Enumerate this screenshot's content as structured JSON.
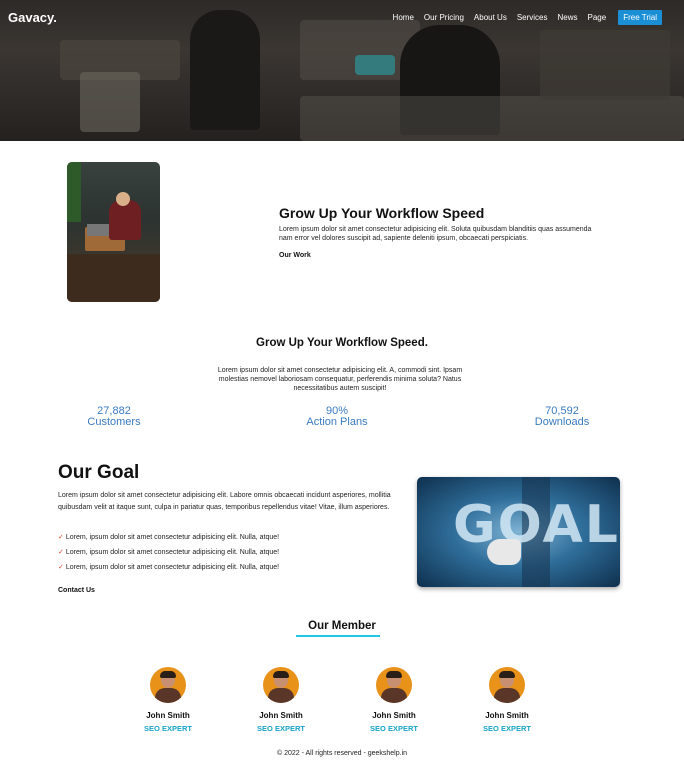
{
  "brand": {
    "logo": "Gavacy."
  },
  "nav": {
    "items": [
      "Home",
      "Our Pricing",
      "About Us",
      "Services",
      "News",
      "Page"
    ],
    "cta": "Free Trial"
  },
  "workflow": {
    "title": "Grow Up Your Workflow Speed",
    "text": "Lorem ipsum dolor sit amet consectetur adipisicing elit. Soluta quibusdam blanditiis quas assumenda nam error vel dolores suscipit ad, sapiente deleniti ipsum, obcaecati perspiciatis.",
    "link": "Our Work"
  },
  "stats_section": {
    "title": "Grow Up Your Workflow Speed.",
    "text": "Lorem ipsum dolor sit amet consectetur adipisicing elit. A, commodi sint. Ipsam molestias nemovel laboriosam consequatur, perferendis minima soluta? Natus necessitatibus autem suscipit!",
    "stats": [
      {
        "value": "27,882",
        "label": "Customers"
      },
      {
        "value": "90%",
        "label": "Action Plans"
      },
      {
        "value": "70,592",
        "label": "Downloads"
      }
    ]
  },
  "goal": {
    "title": "Our Goal",
    "text": "Lorem ipsum dolor sit amet consectetur adipisicing elit. Labore omnis obcaecati incidunt asperiores, mollitia quibusdam velit at itaque sunt, culpa in pariatur quas, temporibus repellendus vitae! Vitae, illum asperiores.",
    "checks": [
      "Lorem, ipsum dolor sit amet consectetur adipisicing elit. Nulla, atque!",
      "Lorem, ipsum dolor sit amet consectetur adipisicing elit. Nulla, atque!",
      "Lorem, ipsum dolor sit amet consectetur adipisicing elit. Nulla, atque!"
    ],
    "check_icon": "✓",
    "link": "Contact Us",
    "image_word": "GOAL"
  },
  "members": {
    "title": "Our Member",
    "list": [
      {
        "name": "John Smith",
        "role": "SEO EXPERT"
      },
      {
        "name": "John Smith",
        "role": "SEO EXPERT"
      },
      {
        "name": "John Smith",
        "role": "SEO EXPERT"
      },
      {
        "name": "John Smith",
        "role": "SEO EXPERT"
      }
    ]
  },
  "footer": {
    "text": "© 2022 - All rights reserved - geekshelp.in"
  },
  "colors": {
    "accent": "#1a8fd6",
    "stat": "#3a7bc0",
    "underline": "#22c6e6",
    "role": "#1aa3c8",
    "tick": "#d9452c"
  }
}
